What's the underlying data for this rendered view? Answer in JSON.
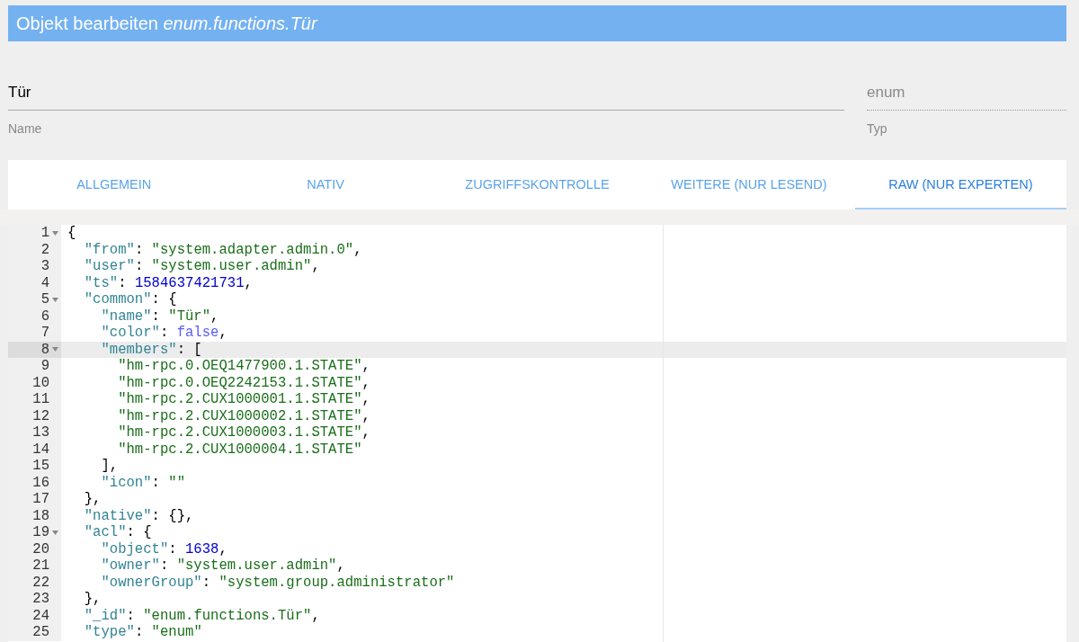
{
  "dialog": {
    "title": "Objekt bearbeiten",
    "object_id": "enum.functions.Tür"
  },
  "fields": [
    {
      "kind": "underline",
      "value": "Tür",
      "label": "Name"
    },
    {
      "kind": "dotted",
      "value": "enum",
      "label": "Typ"
    }
  ],
  "tabs": [
    {
      "label": "ALLGEMEIN",
      "selected": false
    },
    {
      "label": "NATIV",
      "selected": false
    },
    {
      "label": "ZUGRIFFSKONTROLLE",
      "selected": false
    },
    {
      "label": "WEITERE (NUR LESEND)",
      "selected": false
    },
    {
      "label": "RAW (NUR EXPERTEN)",
      "selected": true
    }
  ],
  "editor": {
    "lines": [
      {
        "number": "1",
        "foldable": true,
        "active": false,
        "tokens": [
          {
            "kind": "punct",
            "text": "{"
          }
        ]
      },
      {
        "number": "2",
        "foldable": false,
        "active": false,
        "tokens": [
          {
            "kind": "key",
            "text": "  \"from\""
          },
          {
            "kind": "punct",
            "text": ": "
          },
          {
            "kind": "string",
            "text": "\"system.adapter.admin.0\""
          },
          {
            "kind": "punct",
            "text": ","
          }
        ]
      },
      {
        "number": "3",
        "foldable": false,
        "active": false,
        "tokens": [
          {
            "kind": "key",
            "text": "  \"user\""
          },
          {
            "kind": "punct",
            "text": ": "
          },
          {
            "kind": "string",
            "text": "\"system.user.admin\""
          },
          {
            "kind": "punct",
            "text": ","
          }
        ]
      },
      {
        "number": "4",
        "foldable": false,
        "active": false,
        "tokens": [
          {
            "kind": "key",
            "text": "  \"ts\""
          },
          {
            "kind": "punct",
            "text": ": "
          },
          {
            "kind": "number",
            "text": "1584637421731"
          },
          {
            "kind": "punct",
            "text": ","
          }
        ]
      },
      {
        "number": "5",
        "foldable": true,
        "active": false,
        "tokens": [
          {
            "kind": "key",
            "text": "  \"common\""
          },
          {
            "kind": "punct",
            "text": ": {"
          }
        ]
      },
      {
        "number": "6",
        "foldable": false,
        "active": false,
        "tokens": [
          {
            "kind": "key",
            "text": "    \"name\""
          },
          {
            "kind": "punct",
            "text": ": "
          },
          {
            "kind": "string",
            "text": "\"Tür\""
          },
          {
            "kind": "punct",
            "text": ","
          }
        ]
      },
      {
        "number": "7",
        "foldable": false,
        "active": false,
        "tokens": [
          {
            "kind": "key",
            "text": "    \"color\""
          },
          {
            "kind": "punct",
            "text": ": "
          },
          {
            "kind": "boolean",
            "text": "false"
          },
          {
            "kind": "punct",
            "text": ","
          }
        ]
      },
      {
        "number": "8",
        "foldable": true,
        "active": true,
        "tokens": [
          {
            "kind": "key",
            "text": "    \"members\""
          },
          {
            "kind": "punct",
            "text": ": ["
          }
        ]
      },
      {
        "number": "9",
        "foldable": false,
        "active": false,
        "tokens": [
          {
            "kind": "string",
            "text": "      \"hm-rpc.0.OEQ1477900.1.STATE\""
          },
          {
            "kind": "punct",
            "text": ","
          }
        ]
      },
      {
        "number": "10",
        "foldable": false,
        "active": false,
        "tokens": [
          {
            "kind": "string",
            "text": "      \"hm-rpc.0.OEQ2242153.1.STATE\""
          },
          {
            "kind": "punct",
            "text": ","
          }
        ]
      },
      {
        "number": "11",
        "foldable": false,
        "active": false,
        "tokens": [
          {
            "kind": "string",
            "text": "      \"hm-rpc.2.CUX1000001.1.STATE\""
          },
          {
            "kind": "punct",
            "text": ","
          }
        ]
      },
      {
        "number": "12",
        "foldable": false,
        "active": false,
        "tokens": [
          {
            "kind": "string",
            "text": "      \"hm-rpc.2.CUX1000002.1.STATE\""
          },
          {
            "kind": "punct",
            "text": ","
          }
        ]
      },
      {
        "number": "13",
        "foldable": false,
        "active": false,
        "tokens": [
          {
            "kind": "string",
            "text": "      \"hm-rpc.2.CUX1000003.1.STATE\""
          },
          {
            "kind": "punct",
            "text": ","
          }
        ]
      },
      {
        "number": "14",
        "foldable": false,
        "active": false,
        "tokens": [
          {
            "kind": "string",
            "text": "      \"hm-rpc.2.CUX1000004.1.STATE\""
          }
        ]
      },
      {
        "number": "15",
        "foldable": false,
        "active": false,
        "tokens": [
          {
            "kind": "punct",
            "text": "    ],"
          }
        ]
      },
      {
        "number": "16",
        "foldable": false,
        "active": false,
        "tokens": [
          {
            "kind": "key",
            "text": "    \"icon\""
          },
          {
            "kind": "punct",
            "text": ": "
          },
          {
            "kind": "string",
            "text": "\"\""
          }
        ]
      },
      {
        "number": "17",
        "foldable": false,
        "active": false,
        "tokens": [
          {
            "kind": "punct",
            "text": "  },"
          }
        ]
      },
      {
        "number": "18",
        "foldable": false,
        "active": false,
        "tokens": [
          {
            "kind": "key",
            "text": "  \"native\""
          },
          {
            "kind": "punct",
            "text": ": {},"
          }
        ]
      },
      {
        "number": "19",
        "foldable": true,
        "active": false,
        "tokens": [
          {
            "kind": "key",
            "text": "  \"acl\""
          },
          {
            "kind": "punct",
            "text": ": {"
          }
        ]
      },
      {
        "number": "20",
        "foldable": false,
        "active": false,
        "tokens": [
          {
            "kind": "key",
            "text": "    \"object\""
          },
          {
            "kind": "punct",
            "text": ": "
          },
          {
            "kind": "number",
            "text": "1638"
          },
          {
            "kind": "punct",
            "text": ","
          }
        ]
      },
      {
        "number": "21",
        "foldable": false,
        "active": false,
        "tokens": [
          {
            "kind": "key",
            "text": "    \"owner\""
          },
          {
            "kind": "punct",
            "text": ": "
          },
          {
            "kind": "string",
            "text": "\"system.user.admin\""
          },
          {
            "kind": "punct",
            "text": ","
          }
        ]
      },
      {
        "number": "22",
        "foldable": false,
        "active": false,
        "tokens": [
          {
            "kind": "key",
            "text": "    \"ownerGroup\""
          },
          {
            "kind": "punct",
            "text": ": "
          },
          {
            "kind": "string",
            "text": "\"system.group.administrator\""
          }
        ]
      },
      {
        "number": "23",
        "foldable": false,
        "active": false,
        "tokens": [
          {
            "kind": "punct",
            "text": "  },"
          }
        ]
      },
      {
        "number": "24",
        "foldable": false,
        "active": false,
        "tokens": [
          {
            "kind": "key",
            "text": "  \"_id\""
          },
          {
            "kind": "punct",
            "text": ": "
          },
          {
            "kind": "string",
            "text": "\"enum.functions.Tür\""
          },
          {
            "kind": "punct",
            "text": ","
          }
        ]
      },
      {
        "number": "25",
        "foldable": false,
        "active": false,
        "tokens": [
          {
            "kind": "key",
            "text": "  \"type\""
          },
          {
            "kind": "punct",
            "text": ": "
          },
          {
            "kind": "string",
            "text": "\"enum\""
          }
        ]
      }
    ]
  }
}
